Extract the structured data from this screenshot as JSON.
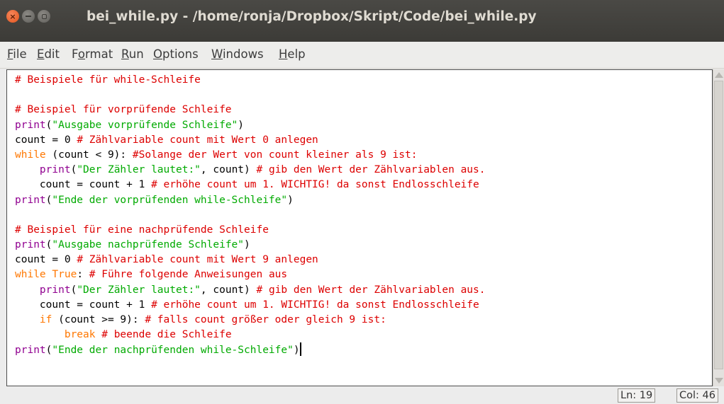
{
  "window": {
    "title": "bei_while.py - /home/ronja/Dropbox/Skript/Code/bei_while.py",
    "close_glyph": "×"
  },
  "menu": {
    "items": [
      {
        "label": "File",
        "u": "F",
        "rest": "ile"
      },
      {
        "label": "Edit",
        "u": "E",
        "rest": "dit"
      },
      {
        "label": "Format",
        "pre": "F",
        "u": "o",
        "rest": "rmat"
      },
      {
        "label": "Run",
        "u": "R",
        "rest": "un"
      },
      {
        "label": "Options",
        "u": "O",
        "rest": "ptions"
      },
      {
        "label": "Windows",
        "u": "W",
        "rest": "indows"
      },
      {
        "label": "Help",
        "u": "H",
        "rest": "elp"
      }
    ]
  },
  "colors": {
    "comment": "#dd0000",
    "string": "#00aa00",
    "keyword": "#ff7700",
    "builtin": "#900090",
    "default": "#000000"
  },
  "code_lines": [
    [
      [
        "comment",
        "# Beispiele für while-Schleife"
      ]
    ],
    [],
    [
      [
        "comment",
        "# Beispiel für vorprüfende Schleife"
      ]
    ],
    [
      [
        "builtin",
        "print"
      ],
      [
        "default",
        "("
      ],
      [
        "string",
        "\"Ausgabe vorprüfende Schleife\""
      ],
      [
        "default",
        ")"
      ]
    ],
    [
      [
        "default",
        "count = 0 "
      ],
      [
        "comment",
        "# Zählvariable count mit Wert 0 anlegen"
      ]
    ],
    [
      [
        "keyword",
        "while"
      ],
      [
        "default",
        " (count < 9): "
      ],
      [
        "comment",
        "#Solange der Wert von count kleiner als 9 ist:"
      ]
    ],
    [
      [
        "default",
        "    "
      ],
      [
        "builtin",
        "print"
      ],
      [
        "default",
        "("
      ],
      [
        "string",
        "\"Der Zähler lautet:\""
      ],
      [
        "default",
        ", count) "
      ],
      [
        "comment",
        "# gib den Wert der Zählvariablen aus."
      ]
    ],
    [
      [
        "default",
        "    count = count + 1 "
      ],
      [
        "comment",
        "# erhöhe count um 1. WICHTIG! da sonst Endlosschleife"
      ]
    ],
    [
      [
        "builtin",
        "print"
      ],
      [
        "default",
        "("
      ],
      [
        "string",
        "\"Ende der vorprüfenden while-Schleife\""
      ],
      [
        "default",
        ")"
      ]
    ],
    [],
    [
      [
        "comment",
        "# Beispiel für eine nachprüfende Schleife"
      ]
    ],
    [
      [
        "builtin",
        "print"
      ],
      [
        "default",
        "("
      ],
      [
        "string",
        "\"Ausgabe nachprüfende Schleife\""
      ],
      [
        "default",
        ")"
      ]
    ],
    [
      [
        "default",
        "count = 0 "
      ],
      [
        "comment",
        "# Zählvariable count mit Wert 9 anlegen"
      ]
    ],
    [
      [
        "keyword",
        "while"
      ],
      [
        "default",
        " "
      ],
      [
        "keyword",
        "True"
      ],
      [
        "default",
        ": "
      ],
      [
        "comment",
        "# Führe folgende Anweisungen aus"
      ]
    ],
    [
      [
        "default",
        "    "
      ],
      [
        "builtin",
        "print"
      ],
      [
        "default",
        "("
      ],
      [
        "string",
        "\"Der Zähler lautet:\""
      ],
      [
        "default",
        ", count) "
      ],
      [
        "comment",
        "# gib den Wert der Zählvariablen aus."
      ]
    ],
    [
      [
        "default",
        "    count = count + 1 "
      ],
      [
        "comment",
        "# erhöhe count um 1. WICHTIG! da sonst Endlosschleife"
      ]
    ],
    [
      [
        "default",
        "    "
      ],
      [
        "keyword",
        "if"
      ],
      [
        "default",
        " (count >= 9): "
      ],
      [
        "comment",
        "# falls count größer oder gleich 9 ist:"
      ]
    ],
    [
      [
        "default",
        "        "
      ],
      [
        "keyword",
        "break"
      ],
      [
        "default",
        " "
      ],
      [
        "comment",
        "# beende die Schleife"
      ]
    ],
    [
      [
        "builtin",
        "print"
      ],
      [
        "default",
        "("
      ],
      [
        "string",
        "\"Ende der nachprüfenden while-Schleife\""
      ],
      [
        "default",
        ")"
      ]
    ]
  ],
  "status": {
    "line": "Ln: 19",
    "col": "Col: 46"
  }
}
